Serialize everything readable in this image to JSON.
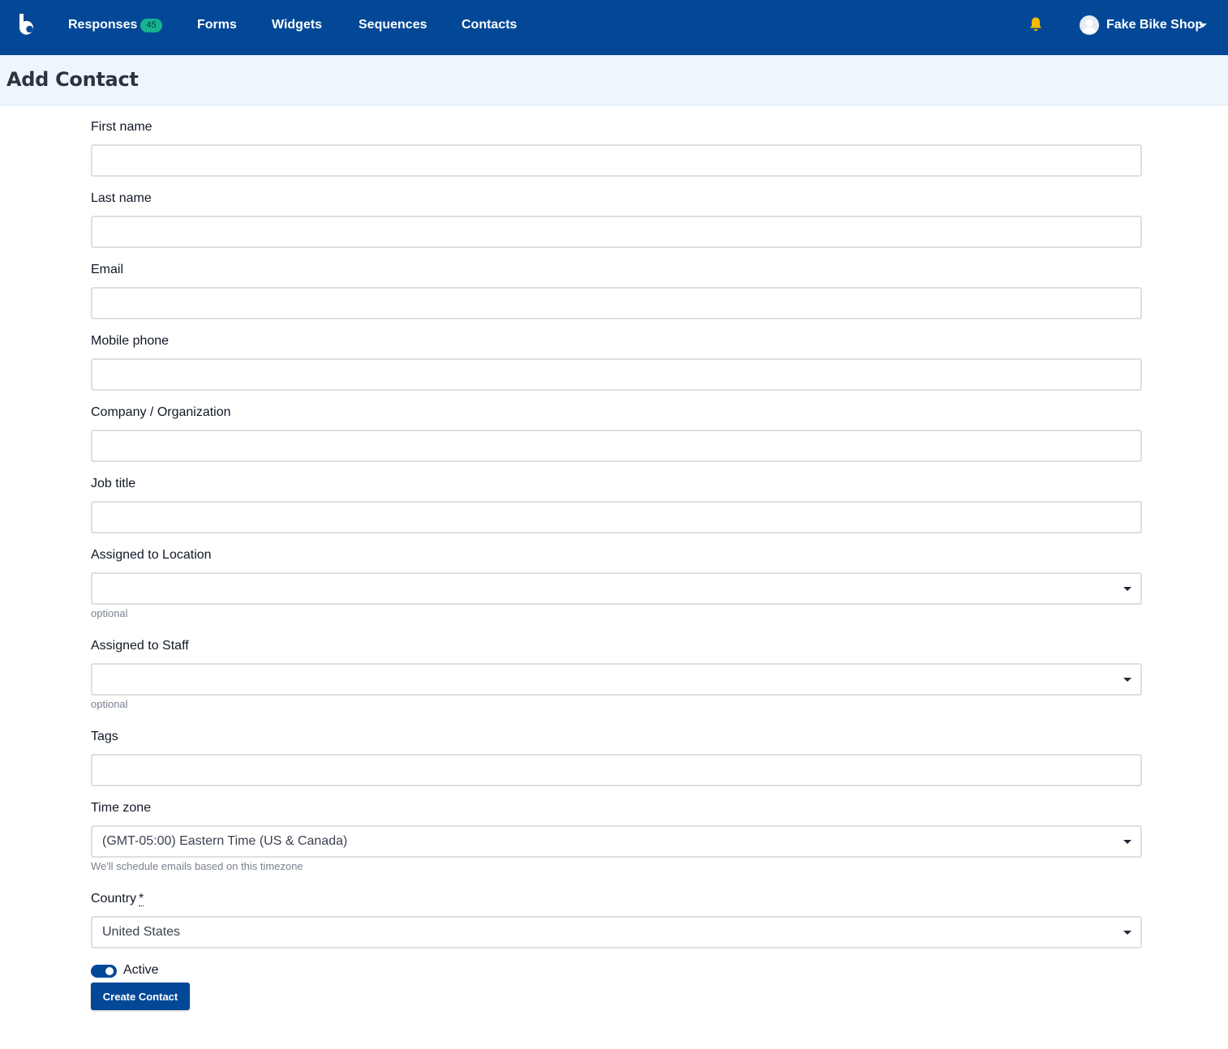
{
  "nav": {
    "logo_icon": "brand-b-logo",
    "items": [
      {
        "label": "Responses",
        "badge": "45"
      },
      {
        "label": "Forms"
      },
      {
        "label": "Widgets"
      },
      {
        "label": "Sequences"
      },
      {
        "label": "Contacts"
      }
    ],
    "bell_icon": "bell-icon",
    "user": {
      "name": "Fake Bike Shop",
      "avatar_icon": "user-avatar-icon"
    }
  },
  "colors": {
    "nav_bg": "#024897",
    "badge_bg": "#17b390",
    "bell": "#f6b800",
    "header_bg": "#eef6fd",
    "button_bg": "#024897"
  },
  "page": {
    "title": "Add Contact"
  },
  "form": {
    "first_name": {
      "label": "First name",
      "value": ""
    },
    "last_name": {
      "label": "Last name",
      "value": ""
    },
    "email": {
      "label": "Email",
      "value": ""
    },
    "mobile_phone": {
      "label": "Mobile phone",
      "value": ""
    },
    "company": {
      "label": "Company / Organization",
      "value": ""
    },
    "job_title": {
      "label": "Job title",
      "value": ""
    },
    "location": {
      "label": "Assigned to Location",
      "value": "",
      "help": "optional"
    },
    "staff": {
      "label": "Assigned to Staff",
      "value": "",
      "help": "optional"
    },
    "tags": {
      "label": "Tags",
      "value": ""
    },
    "time_zone": {
      "label": "Time zone",
      "value": "(GMT-05:00) Eastern Time (US & Canada)",
      "help": "We'll schedule emails based on this timezone"
    },
    "country": {
      "label": "Country",
      "required_mark": "*",
      "value": "United States"
    },
    "active": {
      "label": "Active",
      "checked": true
    },
    "submit_label": "Create Contact"
  }
}
